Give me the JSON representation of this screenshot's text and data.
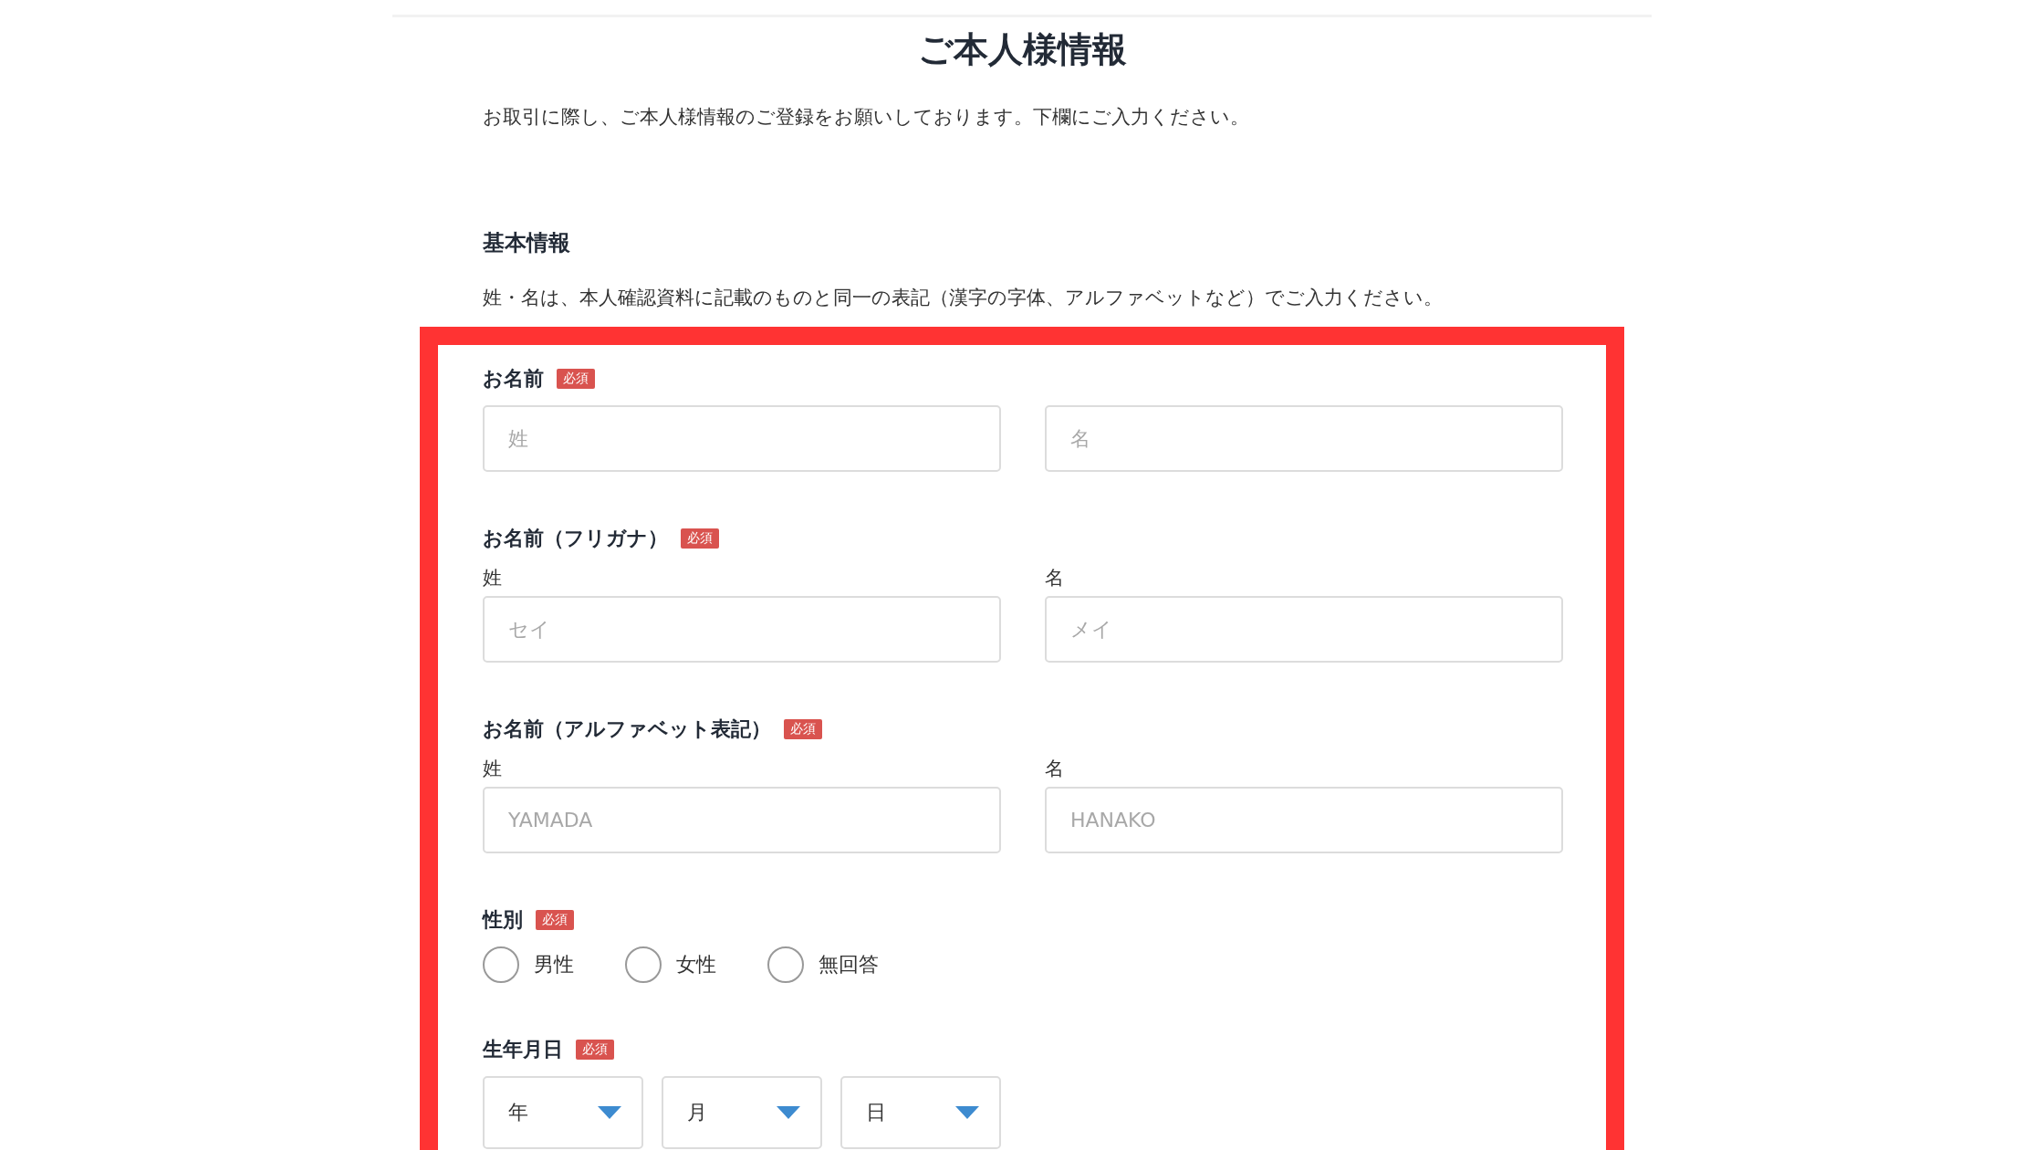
{
  "page": {
    "title": "ご本人様情報",
    "intro": "お取引に際し、ご本人様情報のご登録をお願いしております。下欄にご入力ください。"
  },
  "section": {
    "heading": "基本情報",
    "note": "姓・名は、本人確認資料に記載のものと同一の表記（漢字の字体、アルファベットなど）でご入力ください。"
  },
  "fields": [
    {
      "kind": "text_pair",
      "label": "お名前",
      "badge": "必須",
      "inputs": [
        {
          "placeholder": "姓"
        },
        {
          "placeholder": "名"
        }
      ]
    },
    {
      "kind": "text_pair",
      "label": "お名前（フリガナ）",
      "badge": "必須",
      "inputs": [
        {
          "sublabel": "姓",
          "placeholder": "セイ"
        },
        {
          "sublabel": "名",
          "placeholder": "メイ"
        }
      ]
    },
    {
      "kind": "text_pair",
      "label": "お名前（アルファベット表記）",
      "badge": "必須",
      "inputs": [
        {
          "sublabel": "姓",
          "placeholder": "YAMADA"
        },
        {
          "sublabel": "名",
          "placeholder": "HANAKO"
        }
      ]
    },
    {
      "kind": "radio",
      "label": "性別",
      "badge": "必須",
      "options": [
        {
          "label": "男性",
          "selected": false
        },
        {
          "label": "女性",
          "selected": false
        },
        {
          "label": "無回答",
          "selected": false
        }
      ]
    },
    {
      "kind": "select",
      "label": "生年月日",
      "badge": "必須",
      "selects": [
        {
          "value": "年"
        },
        {
          "value": "月"
        },
        {
          "value": "日"
        }
      ]
    }
  ]
}
